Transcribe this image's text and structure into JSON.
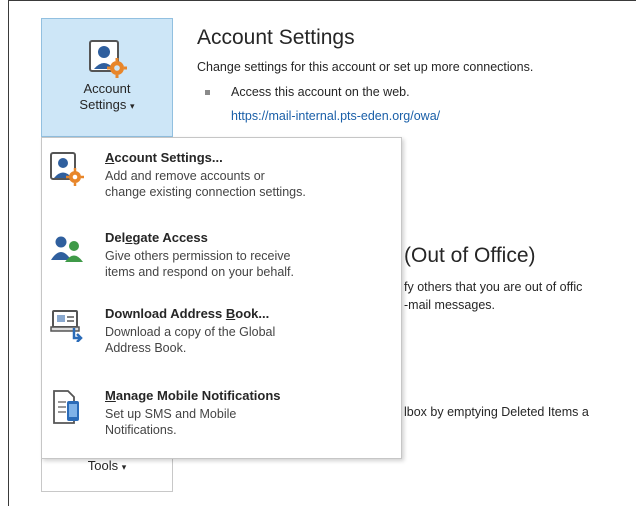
{
  "ribbon": {
    "account_settings_button": {
      "line1": "Account",
      "line2": "Settings",
      "arrow": "▾"
    },
    "tools_button": {
      "label": "Tools",
      "arrow": "▾"
    }
  },
  "account_section": {
    "title": "Account Settings",
    "description": "Change settings for this account or set up more connections.",
    "bullet_text": "Access this account on the web.",
    "owa_link": "https://mail-internal.pts-eden.org/owa/"
  },
  "ooo_section": {
    "title": "(Out of Office)",
    "line1": "fy others that you are out of offic",
    "line2": "-mail messages."
  },
  "cleanup_section": {
    "line1": "lbox by emptying Deleted Items a"
  },
  "menu": {
    "items": [
      {
        "icon": "account-settings-icon",
        "title_pre": "",
        "title_u": "A",
        "title_post": "ccount Settings...",
        "desc1": "Add and remove accounts or",
        "desc2": "change existing connection settings.",
        "desc3": ""
      },
      {
        "icon": "delegate-access-icon",
        "title_pre": "Del",
        "title_u": "e",
        "title_post": "gate Access",
        "desc1": "Give others permission to receive",
        "desc2": "items and respond on your behalf.",
        "desc3": ""
      },
      {
        "icon": "address-book-icon",
        "title_pre": "Download Address ",
        "title_u": "B",
        "title_post": "ook...",
        "desc1": "Download a copy of the Global",
        "desc2": "Address Book.",
        "desc3": ""
      },
      {
        "icon": "mobile-notifications-icon",
        "title_pre": "",
        "title_u": "M",
        "title_post": "anage Mobile Notifications",
        "desc1": "Set up SMS and Mobile",
        "desc2": "Notifications.",
        "desc3": ""
      }
    ]
  }
}
